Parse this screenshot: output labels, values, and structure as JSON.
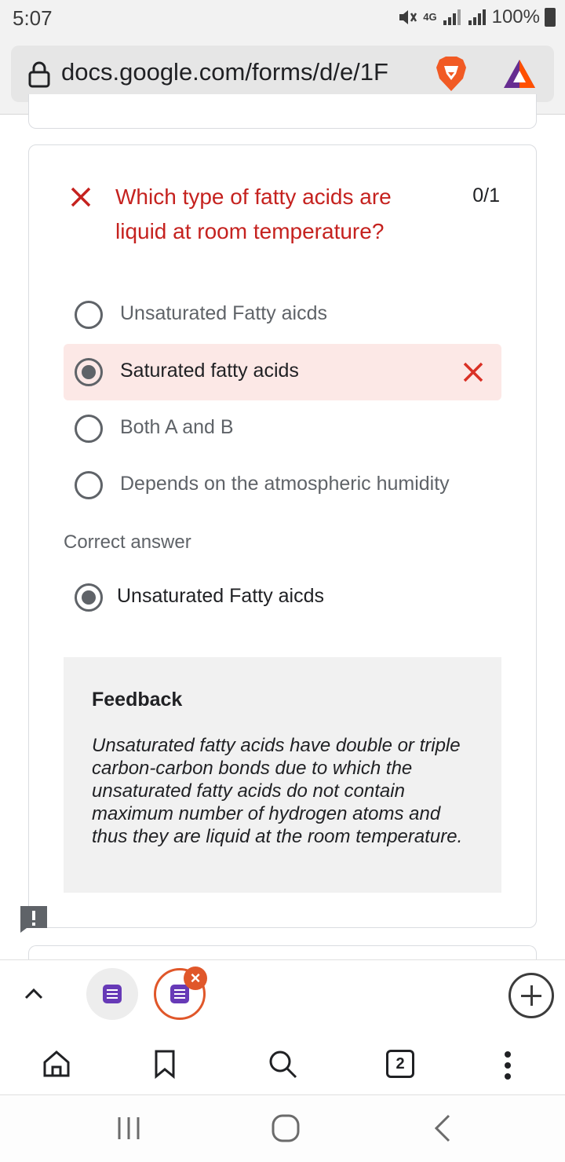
{
  "status_bar": {
    "time": "5:07",
    "network": "4G",
    "battery": "100%"
  },
  "browser": {
    "url": "docs.google.com/forms/d/e/1F",
    "tab_count": "2"
  },
  "question": {
    "title": "Which type of fatty acids are liquid at room temperature?",
    "score": "0/1",
    "options": [
      {
        "label": "Unsaturated Fatty aicds",
        "selected": false,
        "wrong": false
      },
      {
        "label": "Saturated fatty acids",
        "selected": true,
        "wrong": true
      },
      {
        "label": "Both A and B",
        "selected": false,
        "wrong": false
      },
      {
        "label": "Depends on the atmospheric humidity",
        "selected": false,
        "wrong": false
      }
    ],
    "correct_heading": "Correct answer",
    "correct_answer": "Unsaturated Fatty aicds",
    "feedback_title": "Feedback",
    "feedback_text": "Unsaturated fatty acids have double or triple carbon-carbon bonds due to which the unsaturated fatty acids do not contain maximum number of hydrogen atoms and thus they are liquid at the room temperature."
  },
  "colors": {
    "incorrect_red": "#c5221f",
    "wrong_highlight": "#fce8e6",
    "feedback_bg": "#f1f1f1",
    "forms_purple": "#673ab7",
    "brave_orange": "#e0572a"
  }
}
